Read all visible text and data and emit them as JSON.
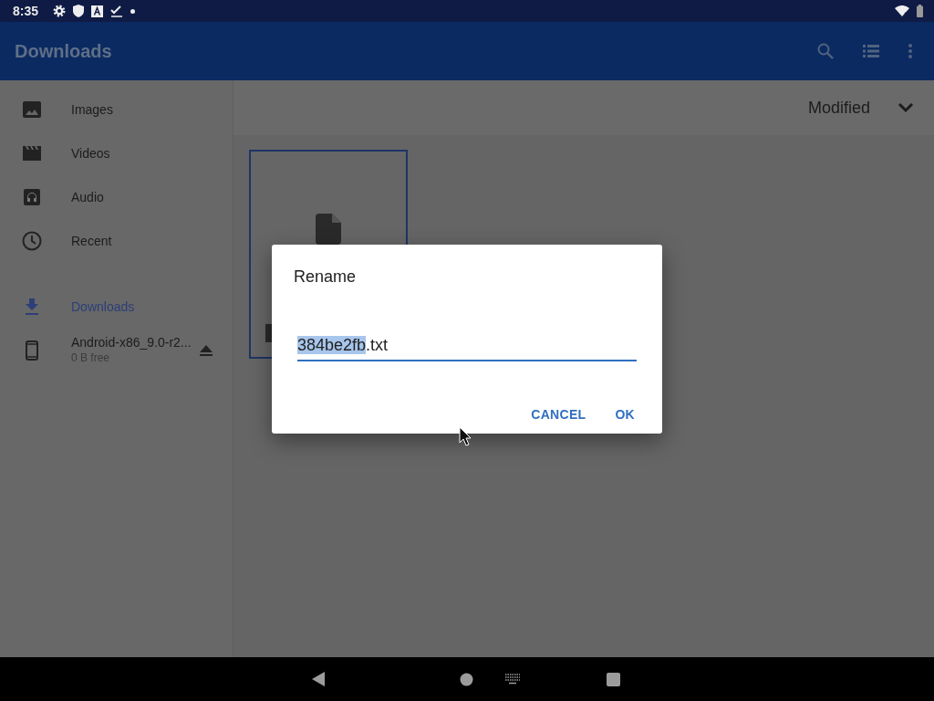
{
  "status_bar": {
    "time": "8:35"
  },
  "app_bar": {
    "title": "Downloads"
  },
  "sidebar": {
    "items": [
      {
        "kind": "images",
        "label": "Images",
        "selected": false
      },
      {
        "kind": "videos",
        "label": "Videos",
        "selected": false
      },
      {
        "kind": "audio",
        "label": "Audio",
        "selected": false
      },
      {
        "kind": "recent",
        "label": "Recent",
        "selected": false
      },
      {
        "kind": "downloads",
        "label": "Downloads",
        "selected": true
      },
      {
        "kind": "device",
        "label": "Android-x86_9.0-r2...",
        "subtitle": "0 B free",
        "selected": false
      }
    ]
  },
  "sort": {
    "label": "Modified"
  },
  "dialog": {
    "title": "Rename",
    "field": [
      {
        "text": "384be2fb",
        "selected": true
      },
      {
        "text": ".txt",
        "selected": false
      }
    ],
    "buttons": [
      "CANCEL",
      "OK"
    ]
  }
}
